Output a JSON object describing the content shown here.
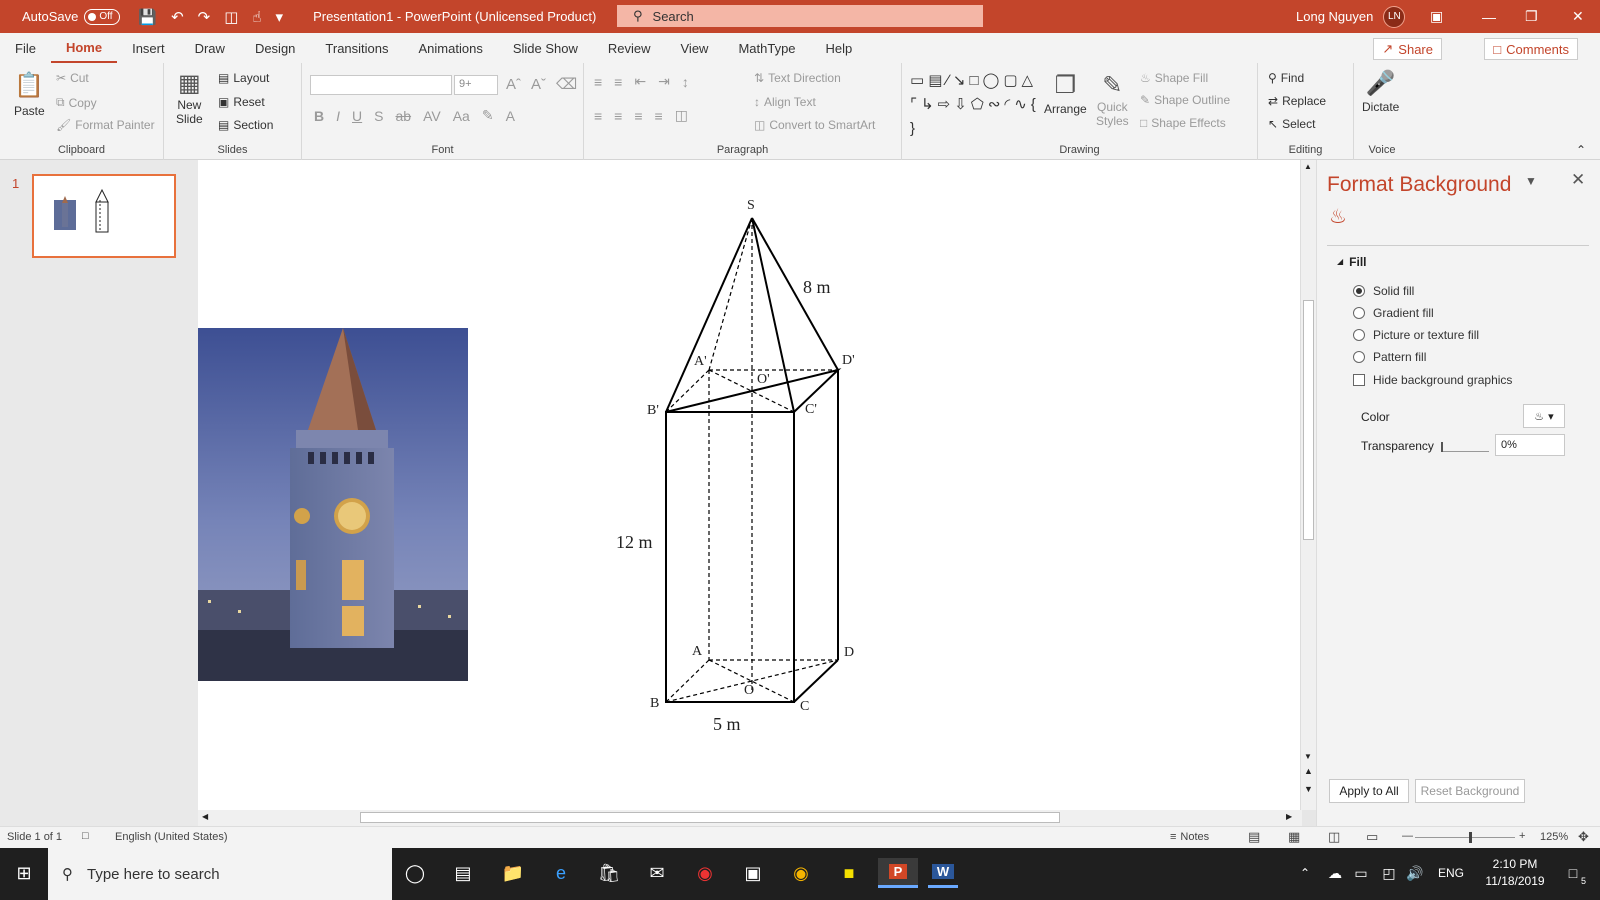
{
  "titlebar": {
    "autosave_label": "AutoSave",
    "autosave_state": "Off",
    "doc_title": "Presentation1  -  PowerPoint (Unlicensed Product)",
    "search_placeholder": "Search",
    "user_name": "Long Nguyen",
    "user_initials": "LN"
  },
  "menu": {
    "tabs": [
      "File",
      "Home",
      "Insert",
      "Draw",
      "Design",
      "Transitions",
      "Animations",
      "Slide Show",
      "Review",
      "View",
      "MathType",
      "Help"
    ],
    "active": "Home",
    "share": "Share",
    "comments": "Comments"
  },
  "ribbon": {
    "clipboard": {
      "label": "Clipboard",
      "paste": "Paste",
      "cut": "Cut",
      "copy": "Copy",
      "format_painter": "Format Painter"
    },
    "slides": {
      "label": "Slides",
      "new_slide_1": "New",
      "new_slide_2": "Slide",
      "layout": "Layout",
      "reset": "Reset",
      "section": "Section"
    },
    "font": {
      "label": "Font",
      "size": "9+"
    },
    "paragraph": {
      "label": "Paragraph",
      "text_direction": "Text Direction",
      "align_text": "Align Text",
      "convert_smartart": "Convert to SmartArt"
    },
    "drawing": {
      "label": "Drawing",
      "arrange": "Arrange",
      "quick_styles_1": "Quick",
      "quick_styles_2": "Styles",
      "shape_fill": "Shape Fill",
      "shape_outline": "Shape Outline",
      "shape_effects": "Shape Effects"
    },
    "editing": {
      "label": "Editing",
      "find": "Find",
      "replace": "Replace",
      "select": "Select"
    },
    "voice": {
      "label": "Voice",
      "dictate": "Dictate"
    }
  },
  "thumbnails": {
    "number": "1"
  },
  "diagram": {
    "labels": {
      "S": "S",
      "A1": "A'",
      "B1": "B'",
      "C1": "C'",
      "D1": "D'",
      "O1": "O'",
      "A": "A",
      "B": "B",
      "C": "C",
      "D": "D",
      "O": "O"
    },
    "dims": {
      "edge": "8 m",
      "height": "12 m",
      "base": "5 m"
    }
  },
  "format_pane": {
    "title": "Format Background",
    "section": "Fill",
    "options": [
      "Solid fill",
      "Gradient fill",
      "Picture or texture fill",
      "Pattern fill"
    ],
    "selected": "Solid fill",
    "hide_bg": "Hide background graphics",
    "color_label": "Color",
    "transparency_label": "Transparency",
    "transparency_value": "0%",
    "apply_all": "Apply to All",
    "reset_bg": "Reset Background"
  },
  "statusbar": {
    "slide": "Slide 1 of 1",
    "language": "English (United States)",
    "notes": "Notes",
    "zoom": "125%"
  },
  "taskbar": {
    "search_placeholder": "Type here to search",
    "lang": "ENG",
    "time": "2:10 PM",
    "date": "11/18/2019",
    "notif_count": "5"
  },
  "colors": {
    "accent": "#c3452b",
    "selection": "#e8713c"
  }
}
